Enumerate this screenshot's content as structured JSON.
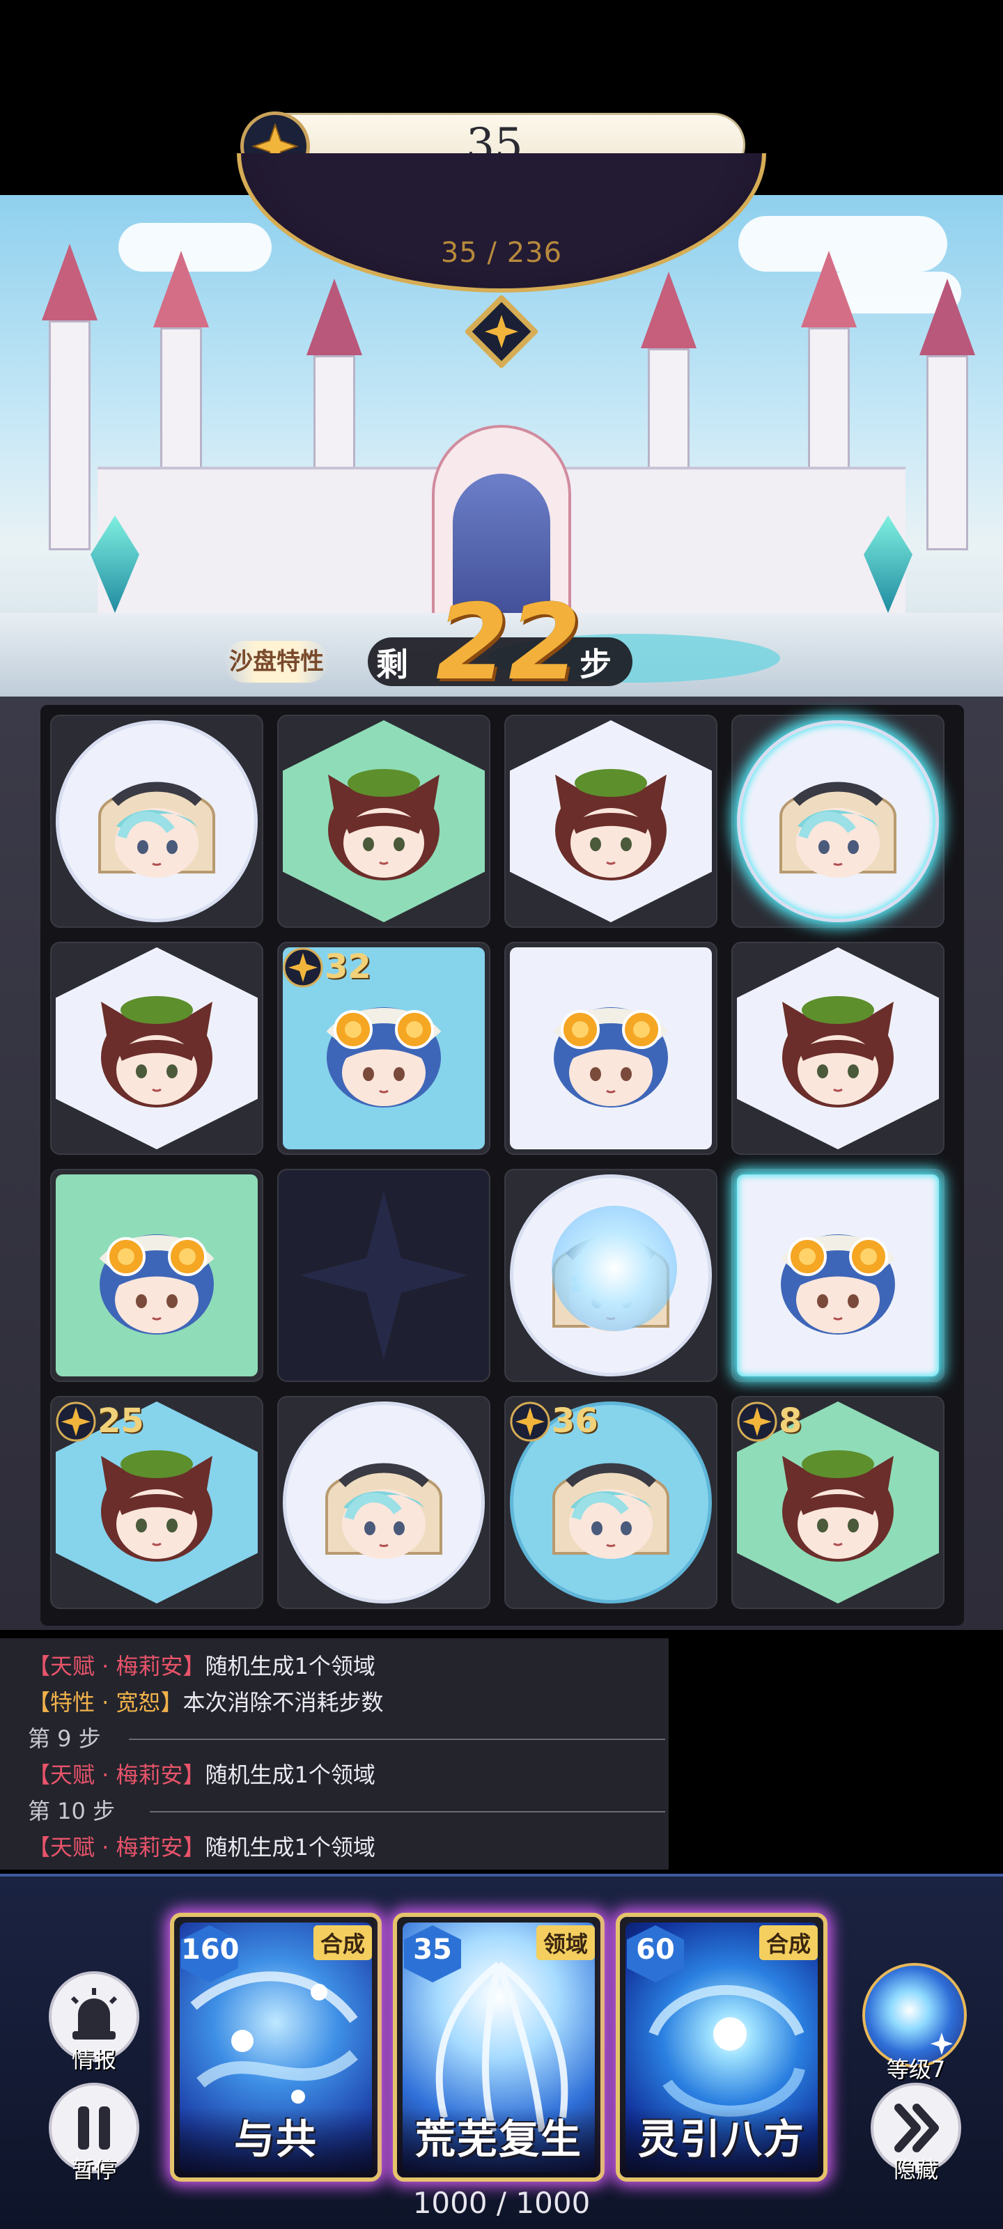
{
  "top": {
    "score": "35"
  },
  "stage": {
    "progress": "35 / 236"
  },
  "sandbox": {
    "label": "沙盘特性",
    "prefix": "剩",
    "remaining": "22",
    "suffix": "步"
  },
  "board": {
    "rows": [
      [
        {
          "shape": "circle",
          "color": "white",
          "hero": "silver-hood-girl",
          "badge": null
        },
        {
          "shape": "hex",
          "color": "green",
          "hero": "leaf-cat-girl",
          "badge": null
        },
        {
          "shape": "hex",
          "color": "white",
          "hero": "leaf-cat-girl",
          "badge": null
        },
        {
          "shape": "circle",
          "color": "white",
          "hero": "silver-hood-girl",
          "badge": null,
          "glow": true
        }
      ],
      [
        {
          "shape": "hex",
          "color": "white",
          "hero": "leaf-cat-girl",
          "badge": null
        },
        {
          "shape": "square",
          "color": "blue",
          "hero": "orange-goggle-girl",
          "badge": "32"
        },
        {
          "shape": "square",
          "color": "white",
          "hero": "orange-goggle-girl",
          "badge": null
        },
        {
          "shape": "hex",
          "color": "white",
          "hero": "leaf-cat-girl",
          "badge": null
        }
      ],
      [
        {
          "shape": "square",
          "color": "green",
          "hero": "orange-goggle-girl",
          "badge": null
        },
        {
          "shape": "empty",
          "color": "none",
          "hero": "none",
          "badge": null
        },
        {
          "shape": "circle",
          "color": "white",
          "hero": "silver-hood-girl",
          "badge": null,
          "frozen": true
        },
        {
          "shape": "square",
          "color": "white",
          "hero": "orange-goggle-girl",
          "badge": null,
          "glow": true
        }
      ],
      [
        {
          "shape": "hex",
          "color": "blue",
          "hero": "leaf-cat-girl",
          "badge": "25"
        },
        {
          "shape": "circle",
          "color": "white",
          "hero": "silver-hood-girl",
          "badge": null
        },
        {
          "shape": "circle",
          "color": "blue",
          "hero": "silver-hood-girl",
          "badge": "36"
        },
        {
          "shape": "hex",
          "color": "green",
          "hero": "leaf-cat-girl",
          "badge": "8"
        }
      ]
    ]
  },
  "log": {
    "lines": [
      {
        "tag": "【天赋 · 梅莉安】",
        "tag_color": "red",
        "text": "随机生成1个领域"
      },
      {
        "tag": "【特性 · 宽恕】",
        "tag_color": "gold",
        "text": "本次消除不消耗步数"
      },
      {
        "step": "第 9 步"
      },
      {
        "tag": "【天赋 · 梅莉安】",
        "tag_color": "red",
        "text": "随机生成1个领域"
      },
      {
        "step": "第 10 步"
      },
      {
        "tag": "【天赋 · 梅莉安】",
        "tag_color": "red",
        "text": "随机生成1个领域"
      }
    ]
  },
  "controls": {
    "info_label": "情报",
    "pause_label": "暂停",
    "level_label": "等级7",
    "hide_label": "隐藏",
    "energy": "1000 / 1000"
  },
  "cards": [
    {
      "cost": "160",
      "type": "合成",
      "name": "与共"
    },
    {
      "cost": "35",
      "type": "领域",
      "name": "荒芜复生"
    },
    {
      "cost": "60",
      "type": "合成",
      "name": "灵引八方"
    }
  ],
  "colors": {
    "accent_gold": "#e5c36b",
    "glow_cyan": "#52e6f2",
    "card_glow": "#d05cf0",
    "log_red": "#e8546a",
    "log_gold": "#f1b24b"
  }
}
